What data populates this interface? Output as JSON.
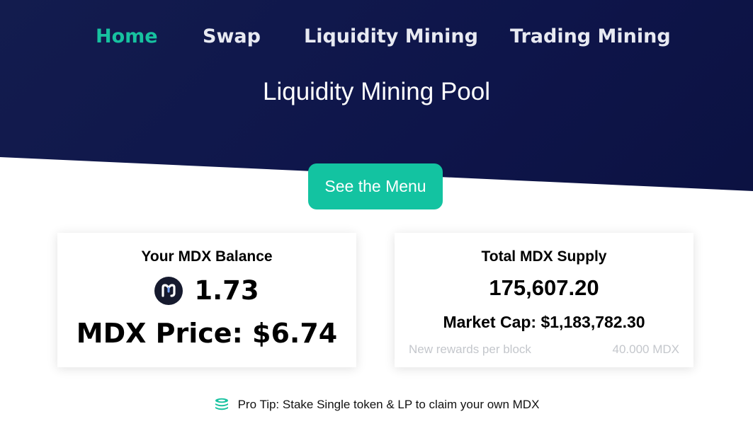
{
  "nav": {
    "items": [
      {
        "label": "Home",
        "active": true
      },
      {
        "label": "Swap",
        "active": false
      },
      {
        "label": "Liquidity Mining",
        "active": false
      },
      {
        "label": "Trading Mining",
        "active": false
      }
    ]
  },
  "hero": {
    "title": "Liquidity Mining Pool",
    "menu_button_label": "See the Menu"
  },
  "balance_card": {
    "title": "Your MDX Balance",
    "token_icon": "mdx-logo-icon",
    "balance": "1.73",
    "price_text": "MDX Price: $6.74"
  },
  "supply_card": {
    "title": "Total MDX Supply",
    "supply": "175,607.20",
    "market_cap_text": "Market Cap: $1,183,782.30",
    "rewards_label": "New rewards per block",
    "rewards_value": "40.000 MDX"
  },
  "tip": {
    "icon": "coins-icon",
    "text": "Pro Tip: Stake Single token & LP to claim your own MDX"
  },
  "colors": {
    "hero_background": "#0e154a",
    "accent": "#13c3a1",
    "nav_text": "#e8eaf2",
    "muted_text": "#c4c7cc"
  }
}
